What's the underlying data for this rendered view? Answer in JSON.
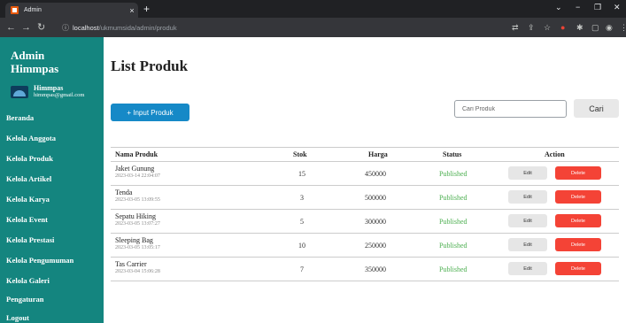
{
  "browser": {
    "tab_title": "Admin",
    "tab_close": "×",
    "new_tab": "+",
    "url_host": "localhost",
    "url_path": "/ukmumsida/admin/produk",
    "controls": {
      "chevron": "⌄",
      "minimize": "−",
      "restore": "❐",
      "close": "✕"
    }
  },
  "sidebar": {
    "brand": "Admin Himmpas",
    "user": {
      "name": "Himmpas",
      "email": "himmpas@gmail.com"
    },
    "items": [
      {
        "label": "Beranda"
      },
      {
        "label": "Kelola Anggota"
      },
      {
        "label": "Kelola Produk"
      },
      {
        "label": "Kelola Artikel"
      },
      {
        "label": "Kelola Karya"
      },
      {
        "label": "Kelola Event"
      },
      {
        "label": "Kelola Prestasi"
      },
      {
        "label": "Kelola Pengumuman"
      },
      {
        "label": "Kelola Galeri"
      },
      {
        "label": "Pengaturan"
      },
      {
        "label": "Logout"
      }
    ]
  },
  "main": {
    "title": "List Produk",
    "add_button": "+ Input Produk",
    "search": {
      "placeholder": "Cari Produk",
      "button": "Cari"
    },
    "table": {
      "headers": {
        "name": "Nama Produk",
        "stock": "Stok",
        "price": "Harga",
        "status": "Status",
        "action": "Action"
      },
      "edit_label": "Edit",
      "delete_label": "Delete",
      "rows": [
        {
          "name": "Jaket Gunung",
          "date": "2023-03-14 22:04:07",
          "stock": "15",
          "price": "450000",
          "status": "Published"
        },
        {
          "name": "Tenda",
          "date": "2023-03-05 13:09:55",
          "stock": "3",
          "price": "500000",
          "status": "Published"
        },
        {
          "name": "Sepatu Hiking",
          "date": "2023-03-05 13:07:27",
          "stock": "5",
          "price": "300000",
          "status": "Published"
        },
        {
          "name": "Sleeping Bag",
          "date": "2023-03-05 13:05:17",
          "stock": "10",
          "price": "250000",
          "status": "Published"
        },
        {
          "name": "Tas Carrier",
          "date": "2023-03-04 15:06:28",
          "stock": "7",
          "price": "350000",
          "status": "Published"
        }
      ]
    }
  },
  "colors": {
    "sidebar": "#14857f",
    "primary": "#1689c7",
    "danger": "#f44336",
    "published": "#4caf50"
  }
}
